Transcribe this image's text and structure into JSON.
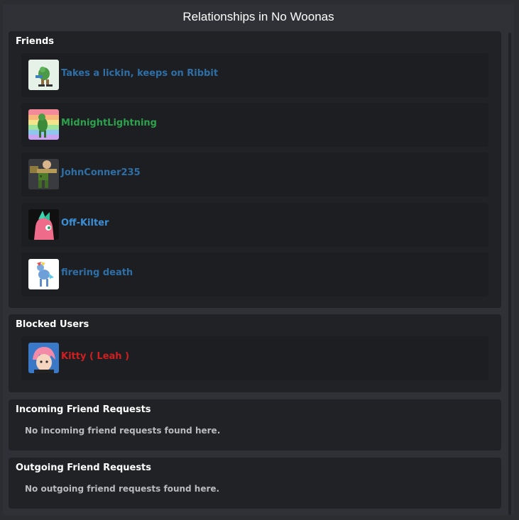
{
  "modal": {
    "title": "Relationships in No Woonas"
  },
  "friends": {
    "title": "Friends",
    "items": [
      {
        "name": "Takes a lickin, keeps on Ribbit",
        "color": "#2e6fa7",
        "avatar_icon": "frog-avatar"
      },
      {
        "name": "MidnightLightning",
        "color": "#2ca24c",
        "avatar_icon": "rainbow-pony-avatar"
      },
      {
        "name": "JohnConner235",
        "color": "#2e6fa7",
        "avatar_icon": "camo-soldier-avatar"
      },
      {
        "name": "Off-Kilter",
        "color": "#3b8fd6",
        "avatar_icon": "pink-pony-avatar"
      },
      {
        "name": "firering death",
        "color": "#2e6fa7",
        "avatar_icon": "blue-pony-avatar"
      }
    ]
  },
  "blocked": {
    "title": "Blocked Users",
    "items": [
      {
        "name": "Kitty ( Leah )",
        "color": "#d11f1f",
        "avatar_icon": "anime-character-avatar"
      }
    ]
  },
  "incoming": {
    "title": "Incoming Friend Requests",
    "empty_text": "No incoming friend requests found here."
  },
  "outgoing": {
    "title": "Outgoing Friend Requests",
    "empty_text": "No outgoing friend requests found here."
  },
  "colors": {
    "background": "#2f3136",
    "section_background": "#202225",
    "row_background": "#1d1e22"
  }
}
